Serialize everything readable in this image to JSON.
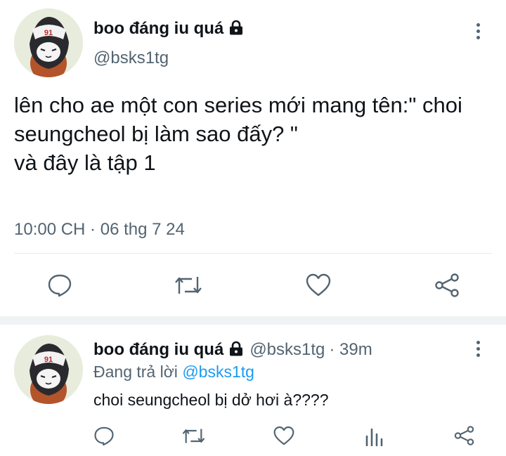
{
  "main_tweet": {
    "author_name": "boo đáng iu quá",
    "author_handle": "@bsks1tg",
    "text": "lên cho ae một con series mới mang tên:\" choi seungcheol bị làm sao đấy? \"\nvà đây là tập 1",
    "timestamp": "10:00 CH · 06 thg 7 24",
    "actions": [
      "reply-icon",
      "retweet-icon",
      "like-icon",
      "share-icon"
    ]
  },
  "reply_tweet": {
    "author_name": "boo đáng iu quá",
    "author_handle": "@bsks1tg",
    "time_ago": "· 39m",
    "replying_prefix": "Đang trả lời",
    "replying_to": "@bsks1tg",
    "text": "choi seungcheol bị dở hơi à????",
    "actions": [
      "reply-icon",
      "retweet-icon",
      "like-icon",
      "views-icon",
      "share-icon"
    ]
  },
  "colors": {
    "text_primary": "#0f1419",
    "text_secondary": "#536471",
    "link": "#1d9bf0",
    "divider": "#e6e9ea"
  }
}
